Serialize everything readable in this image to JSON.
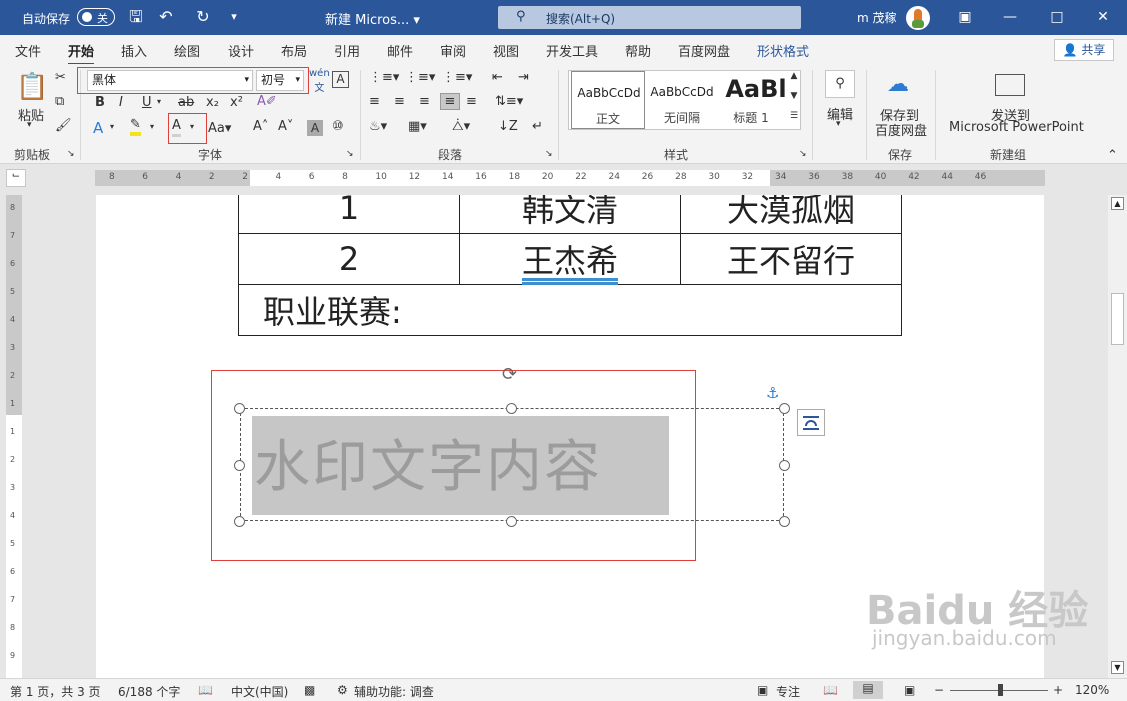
{
  "titlebar": {
    "autosave": "自动保存",
    "toggle": "关",
    "doc_title": "新建 Micros...",
    "search": "搜索(Alt+Q)",
    "user": "m 茂稼"
  },
  "tabs": [
    "文件",
    "开始",
    "插入",
    "绘图",
    "设计",
    "布局",
    "引用",
    "邮件",
    "审阅",
    "视图",
    "开发工具",
    "帮助",
    "百度网盘",
    "形状格式"
  ],
  "share": "共享",
  "ribbon": {
    "clipboard": {
      "paste": "粘贴",
      "label": "剪贴板"
    },
    "font": {
      "name": "黑体",
      "size": "初号",
      "label": "字体"
    },
    "paragraph": {
      "label": "段落"
    },
    "styles": {
      "label": "样式",
      "items": [
        {
          "preview": "AaBbCcDd",
          "name": "正文"
        },
        {
          "preview": "AaBbCcDd",
          "name": "无间隔"
        },
        {
          "preview": "AaBl",
          "name": "标题 1"
        }
      ]
    },
    "editing": {
      "label": "编辑"
    },
    "save": {
      "label1": "保存到",
      "label2": "百度网盘",
      "group": "保存"
    },
    "send": {
      "label1": "发送到",
      "label2": "Microsoft PowerPoint",
      "group": "新建组"
    }
  },
  "ruler": {
    "labels": [
      "8",
      "6",
      "4",
      "2",
      "2",
      "4",
      "6",
      "8",
      "10",
      "12",
      "14",
      "16",
      "18",
      "20",
      "22",
      "24",
      "26",
      "28",
      "30",
      "32",
      "34",
      "36",
      "38",
      "40",
      "42",
      "44",
      "46"
    ]
  },
  "table": [
    [
      "1",
      "韩文清",
      "大漠孤烟"
    ],
    [
      "2",
      "王杰希",
      "王不留行"
    ],
    [
      "职业联赛:"
    ]
  ],
  "watermark": "水印文字内容",
  "status": {
    "page": "第 1 页，共 3 页",
    "words": "6/188 个字",
    "lang": "中文(中国)",
    "access": "辅助功能: 调查",
    "focus": "专注",
    "zoom": "120%"
  },
  "brand": {
    "logo": "Baidu 经验",
    "url": "jingyan.baidu.com"
  },
  "colors": {
    "titlebar": "#2b579a",
    "highlight": "#e0403a"
  }
}
